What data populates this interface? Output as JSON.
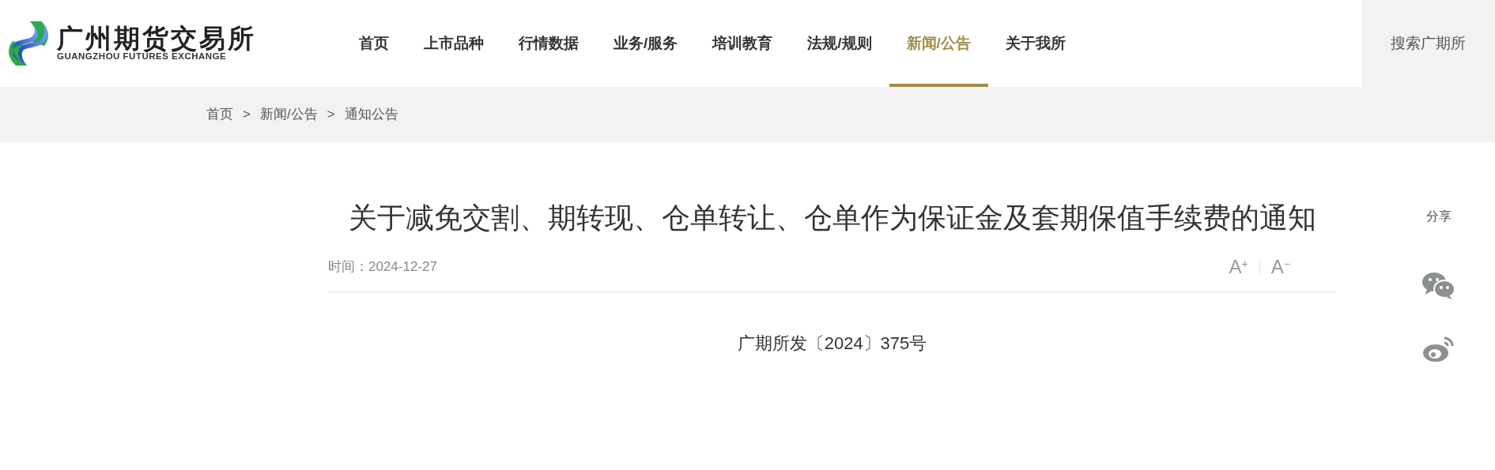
{
  "logo": {
    "name": "广州期货交易所",
    "english": "GUANGZHOU FUTURES EXCHANGE"
  },
  "nav": [
    {
      "label": "首页",
      "selected": false
    },
    {
      "label": "上市品种",
      "selected": false
    },
    {
      "label": "行情数据",
      "selected": false
    },
    {
      "label": "业务/服务",
      "selected": false
    },
    {
      "label": "培训教育",
      "selected": false
    },
    {
      "label": "法规/规则",
      "selected": false
    },
    {
      "label": "新闻/公告",
      "selected": true
    },
    {
      "label": "关于我所",
      "selected": false
    }
  ],
  "search": {
    "label": "搜索广期所"
  },
  "breadcrumb": [
    "首页",
    "新闻/公告",
    "通知公告"
  ],
  "breadcrumb_separator": ">",
  "article": {
    "title": "关于减免交割、期转现、仓单转让、仓单作为保证金及套期保值手续费的通知",
    "time": "时间：2024-12-27",
    "font_controls": [
      "A$^{+}$",
      "A$^{−}$"
    ],
    "doc_number": "广期所发〔2024〕375号"
  },
  "share": {
    "label": "分享",
    "items": [
      {
        "kind": "wechat"
      },
      {
        "kind": "weibo"
      }
    ]
  }
}
